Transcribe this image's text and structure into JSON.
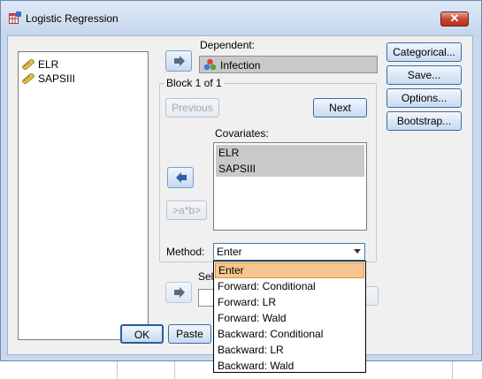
{
  "window": {
    "title": "Logistic Regression",
    "close_glyph": "✕"
  },
  "source_list": {
    "items": [
      {
        "label": "ELR",
        "icon": "scale-variable-icon"
      },
      {
        "label": "SAPSIII",
        "icon": "scale-variable-icon"
      }
    ]
  },
  "dependent": {
    "label": "Dependent:",
    "value": "Infection",
    "icon": "nominal-variable-icon"
  },
  "block": {
    "title": "Block 1 of 1",
    "previous": "Previous",
    "next": "Next"
  },
  "covariates": {
    "label": "Covariates:",
    "items": [
      "ELR",
      "SAPSIII"
    ]
  },
  "interaction_button": ">a*b>",
  "method": {
    "label": "Method:",
    "selected": "Enter",
    "options": [
      "Enter",
      "Forward: Conditional",
      "Forward: LR",
      "Forward: Wald",
      "Backward: Conditional",
      "Backward: LR",
      "Backward: Wald"
    ]
  },
  "selection": {
    "label_partial": "Sel"
  },
  "side_buttons": {
    "categorical": "Categorical...",
    "save": "Save...",
    "options": "Options...",
    "bootstrap": "Bootstrap..."
  },
  "bottom_buttons": {
    "ok": "OK",
    "paste": "Paste"
  }
}
